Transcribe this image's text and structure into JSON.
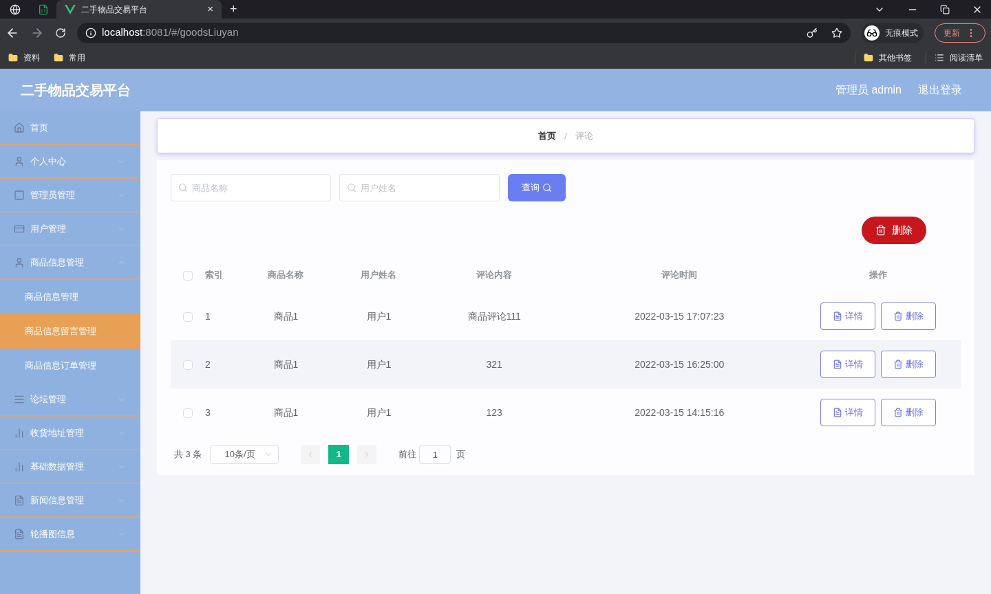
{
  "browser": {
    "tabs": [
      {
        "kind": "globe",
        "selected": false
      },
      {
        "kind": "sheet",
        "selected": false
      },
      {
        "kind": "page",
        "title": "二手物品交易平台",
        "close": "×",
        "selected": true
      }
    ],
    "new_tab": "+",
    "url_host": "localhost",
    "url_path": ":8081/#/goodsLiuyan",
    "profile": "无痕模式",
    "update": "更新",
    "bookmarks": [
      "资料",
      "常用"
    ],
    "bookmarks_right": [
      "其他书签",
      "阅读清单"
    ]
  },
  "header": {
    "title": "二手物品交易平台",
    "user": "管理员 admin",
    "logout": "退出登录"
  },
  "sidebar": {
    "items": [
      {
        "kind": "link",
        "label": "首页",
        "selected": false
      },
      {
        "kind": "group",
        "label": "个人中心",
        "expanded": false,
        "selected": false
      },
      {
        "kind": "group",
        "label": "管理员管理",
        "expanded": false,
        "selected": false
      },
      {
        "kind": "group",
        "label": "用户管理",
        "expanded": false,
        "selected": false
      },
      {
        "kind": "group",
        "label": "商品信息管理",
        "expanded": true,
        "selected": false
      },
      {
        "kind": "sub",
        "label": "商品信息管理",
        "selected": false
      },
      {
        "kind": "sub",
        "label": "商品信息留言管理",
        "selected": true
      },
      {
        "kind": "sub",
        "label": "商品信息订单管理",
        "selected": false
      },
      {
        "kind": "group",
        "label": "论坛管理",
        "expanded": false,
        "selected": false
      },
      {
        "kind": "group",
        "label": "收货地址管理",
        "expanded": false,
        "selected": false
      },
      {
        "kind": "group",
        "label": "基础数据管理",
        "expanded": false,
        "selected": false
      },
      {
        "kind": "group",
        "label": "新闻信息管理",
        "expanded": false,
        "selected": false
      },
      {
        "kind": "group",
        "label": "轮播图信息",
        "expanded": false,
        "selected": false
      }
    ]
  },
  "breadcrumb": [
    "首页",
    "评论"
  ],
  "breadcrumb_separator": "/",
  "search": {
    "fields": [
      {
        "placeholder": "商品名称"
      },
      {
        "placeholder": "用户姓名"
      }
    ],
    "button": "查询"
  },
  "delete_button": "删除",
  "table": {
    "columns": [
      "索引",
      "商品名称",
      "用户姓名",
      "评论内容",
      "评论时间",
      "操作"
    ],
    "all_checked": false,
    "rows": [
      {
        "checked": false,
        "cells": [
          "1",
          "商品1",
          "用户1",
          "商品评论111",
          "2022-03-15 17:07:23"
        ],
        "actions": [
          "详情",
          "删除"
        ]
      },
      {
        "checked": false,
        "cells": [
          "2",
          "商品1",
          "用户1",
          "321",
          "2022-03-15 16:25:00"
        ],
        "actions": [
          "详情",
          "删除"
        ]
      },
      {
        "checked": false,
        "cells": [
          "3",
          "商品1",
          "用户1",
          "123",
          "2022-03-15 14:15:16"
        ],
        "actions": [
          "详情",
          "删除"
        ]
      }
    ]
  },
  "pagination": {
    "total": "共 3 条",
    "page_size": "10条/页",
    "pages": [
      {
        "label": "1",
        "selected": true
      }
    ],
    "goto": "前往",
    "goto_value": "1",
    "page_unit": "页"
  }
}
